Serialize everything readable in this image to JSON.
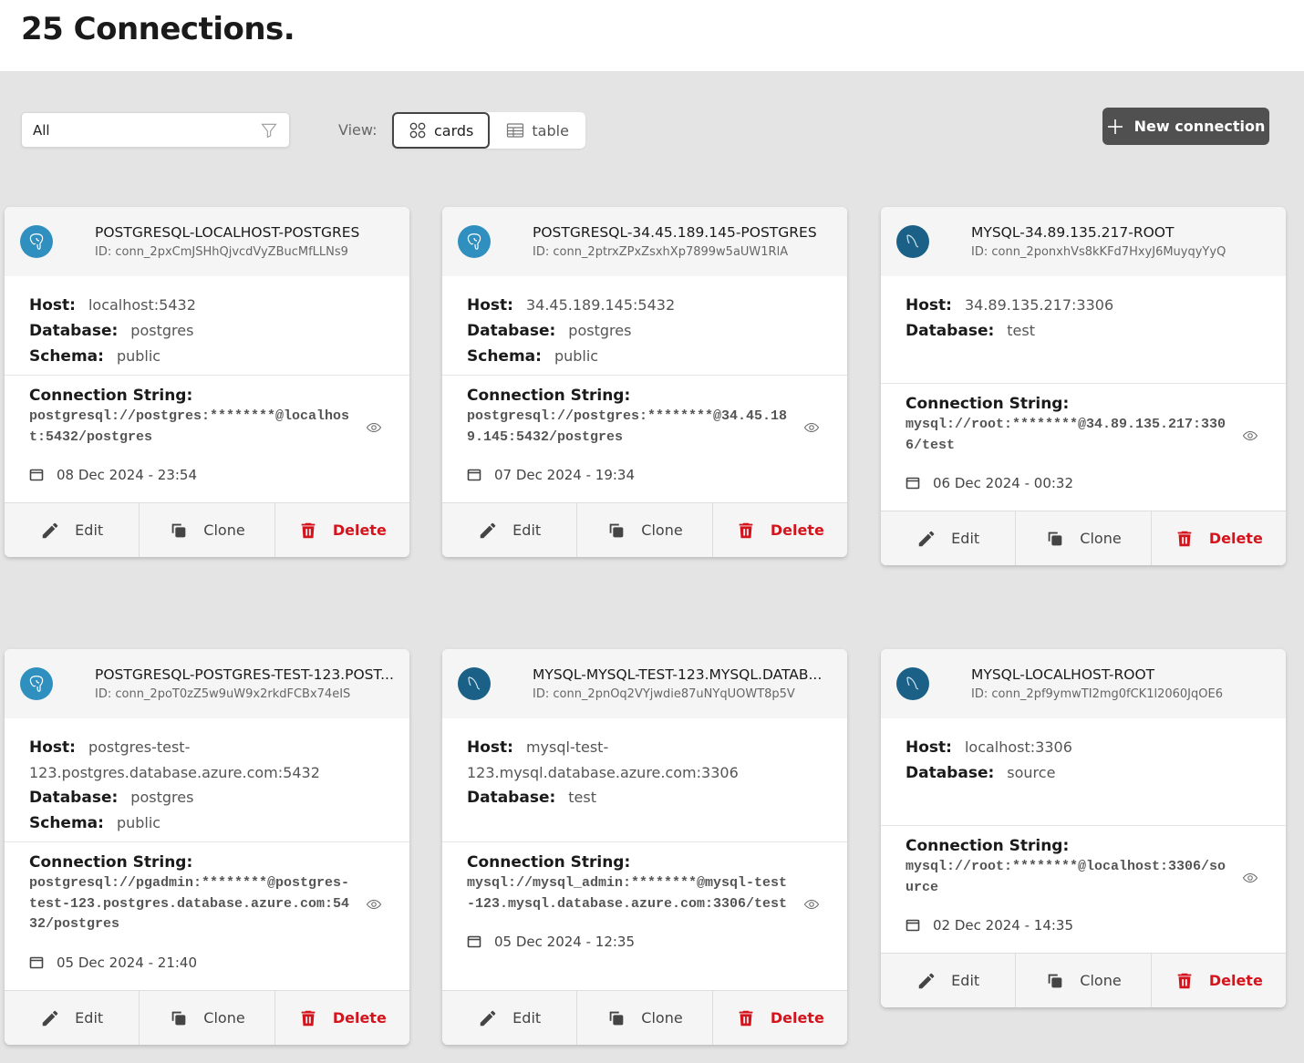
{
  "page": {
    "title": "25 Connections."
  },
  "toolbar": {
    "filter_value": "All",
    "view_label": "View:",
    "views": [
      {
        "label": "cards",
        "icon": "grid-icon",
        "active": true
      },
      {
        "label": "table",
        "icon": "table-icon",
        "active": false
      }
    ],
    "new_button_label": "New connection"
  },
  "labels": {
    "host": "Host:",
    "database": "Database:",
    "schema": "Schema:",
    "connection_string": "Connection String:",
    "edit": "Edit",
    "clone": "Clone",
    "delete": "Delete"
  },
  "colors": {
    "postgres_logo": "#2f8fbf",
    "mysql_logo": "#1b6187",
    "delete": "#d4141c",
    "primary_button": "#505050"
  },
  "connections": [
    {
      "type": "postgres",
      "title": "POSTGRESQL-LOCALHOST-POSTGRES",
      "id": "ID: conn_2pxCmJSHhQjvcdVyZBucMfLLNs9",
      "host": "localhost:5432",
      "database": "postgres",
      "schema": "public",
      "connection_string": "postgresql://postgres:********@localhost:5432/postgres",
      "date": "08 Dec 2024 - 23:54"
    },
    {
      "type": "postgres",
      "title": "POSTGRESQL-34.45.189.145-POSTGRES",
      "id": "ID: conn_2ptrxZPxZsxhXp7899w5aUW1RlA",
      "host": "34.45.189.145:5432",
      "database": "postgres",
      "schema": "public",
      "connection_string": "postgresql://postgres:********@34.45.189.145:5432/postgres",
      "date": "07 Dec 2024 - 19:34"
    },
    {
      "type": "mysql",
      "title": "MYSQL-34.89.135.217-ROOT",
      "id": "ID: conn_2ponxhVs8kKFd7HxyJ6MuyqyYyQ",
      "host": "34.89.135.217:3306",
      "database": "test",
      "schema": null,
      "connection_string": "mysql://root:********@34.89.135.217:3306/test",
      "date": "06 Dec 2024 - 00:32"
    },
    {
      "type": "postgres",
      "title": "POSTGRESQL-POSTGRES-TEST-123.POST...",
      "id": "ID: conn_2poT0zZ5w9uW9x2rkdFCBx74eIS",
      "host": "postgres-test-123.postgres.database.azure.com:5432",
      "database": "postgres",
      "schema": "public",
      "connection_string": "postgresql://pgadmin:********@postgres-test-123.postgres.database.azure.com:5432/postgres",
      "date": "05 Dec 2024 - 21:40"
    },
    {
      "type": "mysql",
      "title": "MYSQL-MYSQL-TEST-123.MYSQL.DATAB...",
      "id": "ID: conn_2pnOq2VYjwdie87uNYqUOWT8p5V",
      "host": "mysql-test-123.mysql.database.azure.com:3306",
      "database": "test",
      "schema": null,
      "connection_string": "mysql://mysql_admin:********@mysql-test-123.mysql.database.azure.com:3306/test",
      "date": "05 Dec 2024 - 12:35"
    },
    {
      "type": "mysql",
      "title": "MYSQL-LOCALHOST-ROOT",
      "id": "ID: conn_2pf9ymwTI2mg0fCK1l2060JqOE6",
      "host": "localhost:3306",
      "database": "source",
      "schema": null,
      "connection_string": "mysql://root:********@localhost:3306/source",
      "date": "02 Dec 2024 - 14:35"
    }
  ]
}
